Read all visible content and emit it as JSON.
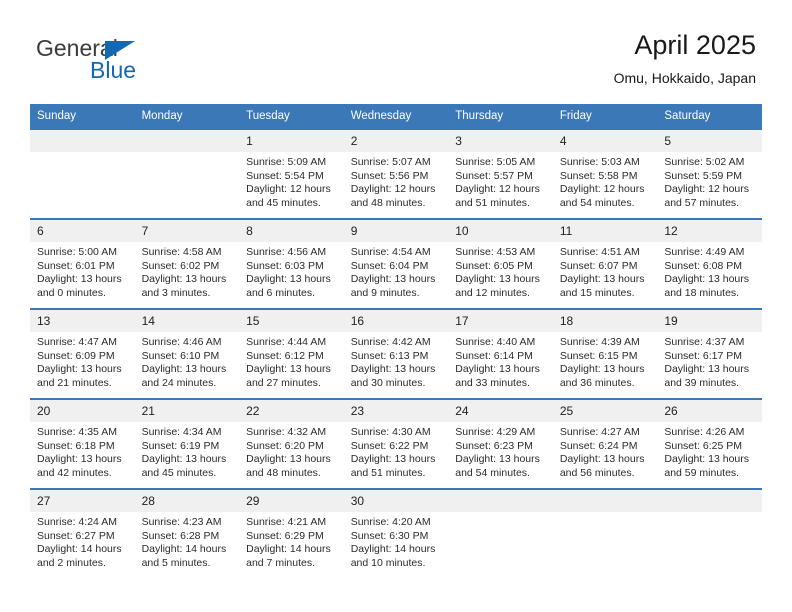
{
  "brand": {
    "name_top": "General",
    "name_bottom": "Blue",
    "accent_color": "#1268b3"
  },
  "header": {
    "title": "April 2025",
    "subtitle": "Omu, Hokkaido, Japan"
  },
  "calendar": {
    "header_bg": "#3b78b7",
    "daynum_bg": "#f0f0f0",
    "weekday_headers": [
      "Sunday",
      "Monday",
      "Tuesday",
      "Wednesday",
      "Thursday",
      "Friday",
      "Saturday"
    ],
    "labels": {
      "sunrise": "Sunrise:",
      "sunset": "Sunset:",
      "daylight": "Daylight:"
    },
    "weeks": [
      [
        {
          "day": "",
          "empty": true
        },
        {
          "day": "",
          "empty": true
        },
        {
          "day": "1",
          "sunrise": "Sunrise: 5:09 AM",
          "sunset": "Sunset: 5:54 PM",
          "daylight_line1": "Daylight: 12 hours",
          "daylight_line2": "and 45 minutes."
        },
        {
          "day": "2",
          "sunrise": "Sunrise: 5:07 AM",
          "sunset": "Sunset: 5:56 PM",
          "daylight_line1": "Daylight: 12 hours",
          "daylight_line2": "and 48 minutes."
        },
        {
          "day": "3",
          "sunrise": "Sunrise: 5:05 AM",
          "sunset": "Sunset: 5:57 PM",
          "daylight_line1": "Daylight: 12 hours",
          "daylight_line2": "and 51 minutes."
        },
        {
          "day": "4",
          "sunrise": "Sunrise: 5:03 AM",
          "sunset": "Sunset: 5:58 PM",
          "daylight_line1": "Daylight: 12 hours",
          "daylight_line2": "and 54 minutes."
        },
        {
          "day": "5",
          "sunrise": "Sunrise: 5:02 AM",
          "sunset": "Sunset: 5:59 PM",
          "daylight_line1": "Daylight: 12 hours",
          "daylight_line2": "and 57 minutes."
        }
      ],
      [
        {
          "day": "6",
          "sunrise": "Sunrise: 5:00 AM",
          "sunset": "Sunset: 6:01 PM",
          "daylight_line1": "Daylight: 13 hours",
          "daylight_line2": "and 0 minutes."
        },
        {
          "day": "7",
          "sunrise": "Sunrise: 4:58 AM",
          "sunset": "Sunset: 6:02 PM",
          "daylight_line1": "Daylight: 13 hours",
          "daylight_line2": "and 3 minutes."
        },
        {
          "day": "8",
          "sunrise": "Sunrise: 4:56 AM",
          "sunset": "Sunset: 6:03 PM",
          "daylight_line1": "Daylight: 13 hours",
          "daylight_line2": "and 6 minutes."
        },
        {
          "day": "9",
          "sunrise": "Sunrise: 4:54 AM",
          "sunset": "Sunset: 6:04 PM",
          "daylight_line1": "Daylight: 13 hours",
          "daylight_line2": "and 9 minutes."
        },
        {
          "day": "10",
          "sunrise": "Sunrise: 4:53 AM",
          "sunset": "Sunset: 6:05 PM",
          "daylight_line1": "Daylight: 13 hours",
          "daylight_line2": "and 12 minutes."
        },
        {
          "day": "11",
          "sunrise": "Sunrise: 4:51 AM",
          "sunset": "Sunset: 6:07 PM",
          "daylight_line1": "Daylight: 13 hours",
          "daylight_line2": "and 15 minutes."
        },
        {
          "day": "12",
          "sunrise": "Sunrise: 4:49 AM",
          "sunset": "Sunset: 6:08 PM",
          "daylight_line1": "Daylight: 13 hours",
          "daylight_line2": "and 18 minutes."
        }
      ],
      [
        {
          "day": "13",
          "sunrise": "Sunrise: 4:47 AM",
          "sunset": "Sunset: 6:09 PM",
          "daylight_line1": "Daylight: 13 hours",
          "daylight_line2": "and 21 minutes."
        },
        {
          "day": "14",
          "sunrise": "Sunrise: 4:46 AM",
          "sunset": "Sunset: 6:10 PM",
          "daylight_line1": "Daylight: 13 hours",
          "daylight_line2": "and 24 minutes."
        },
        {
          "day": "15",
          "sunrise": "Sunrise: 4:44 AM",
          "sunset": "Sunset: 6:12 PM",
          "daylight_line1": "Daylight: 13 hours",
          "daylight_line2": "and 27 minutes."
        },
        {
          "day": "16",
          "sunrise": "Sunrise: 4:42 AM",
          "sunset": "Sunset: 6:13 PM",
          "daylight_line1": "Daylight: 13 hours",
          "daylight_line2": "and 30 minutes."
        },
        {
          "day": "17",
          "sunrise": "Sunrise: 4:40 AM",
          "sunset": "Sunset: 6:14 PM",
          "daylight_line1": "Daylight: 13 hours",
          "daylight_line2": "and 33 minutes."
        },
        {
          "day": "18",
          "sunrise": "Sunrise: 4:39 AM",
          "sunset": "Sunset: 6:15 PM",
          "daylight_line1": "Daylight: 13 hours",
          "daylight_line2": "and 36 minutes."
        },
        {
          "day": "19",
          "sunrise": "Sunrise: 4:37 AM",
          "sunset": "Sunset: 6:17 PM",
          "daylight_line1": "Daylight: 13 hours",
          "daylight_line2": "and 39 minutes."
        }
      ],
      [
        {
          "day": "20",
          "sunrise": "Sunrise: 4:35 AM",
          "sunset": "Sunset: 6:18 PM",
          "daylight_line1": "Daylight: 13 hours",
          "daylight_line2": "and 42 minutes."
        },
        {
          "day": "21",
          "sunrise": "Sunrise: 4:34 AM",
          "sunset": "Sunset: 6:19 PM",
          "daylight_line1": "Daylight: 13 hours",
          "daylight_line2": "and 45 minutes."
        },
        {
          "day": "22",
          "sunrise": "Sunrise: 4:32 AM",
          "sunset": "Sunset: 6:20 PM",
          "daylight_line1": "Daylight: 13 hours",
          "daylight_line2": "and 48 minutes."
        },
        {
          "day": "23",
          "sunrise": "Sunrise: 4:30 AM",
          "sunset": "Sunset: 6:22 PM",
          "daylight_line1": "Daylight: 13 hours",
          "daylight_line2": "and 51 minutes."
        },
        {
          "day": "24",
          "sunrise": "Sunrise: 4:29 AM",
          "sunset": "Sunset: 6:23 PM",
          "daylight_line1": "Daylight: 13 hours",
          "daylight_line2": "and 54 minutes."
        },
        {
          "day": "25",
          "sunrise": "Sunrise: 4:27 AM",
          "sunset": "Sunset: 6:24 PM",
          "daylight_line1": "Daylight: 13 hours",
          "daylight_line2": "and 56 minutes."
        },
        {
          "day": "26",
          "sunrise": "Sunrise: 4:26 AM",
          "sunset": "Sunset: 6:25 PM",
          "daylight_line1": "Daylight: 13 hours",
          "daylight_line2": "and 59 minutes."
        }
      ],
      [
        {
          "day": "27",
          "sunrise": "Sunrise: 4:24 AM",
          "sunset": "Sunset: 6:27 PM",
          "daylight_line1": "Daylight: 14 hours",
          "daylight_line2": "and 2 minutes."
        },
        {
          "day": "28",
          "sunrise": "Sunrise: 4:23 AM",
          "sunset": "Sunset: 6:28 PM",
          "daylight_line1": "Daylight: 14 hours",
          "daylight_line2": "and 5 minutes."
        },
        {
          "day": "29",
          "sunrise": "Sunrise: 4:21 AM",
          "sunset": "Sunset: 6:29 PM",
          "daylight_line1": "Daylight: 14 hours",
          "daylight_line2": "and 7 minutes."
        },
        {
          "day": "30",
          "sunrise": "Sunrise: 4:20 AM",
          "sunset": "Sunset: 6:30 PM",
          "daylight_line1": "Daylight: 14 hours",
          "daylight_line2": "and 10 minutes."
        },
        {
          "day": "",
          "empty": true
        },
        {
          "day": "",
          "empty": true
        },
        {
          "day": "",
          "empty": true
        }
      ]
    ]
  }
}
